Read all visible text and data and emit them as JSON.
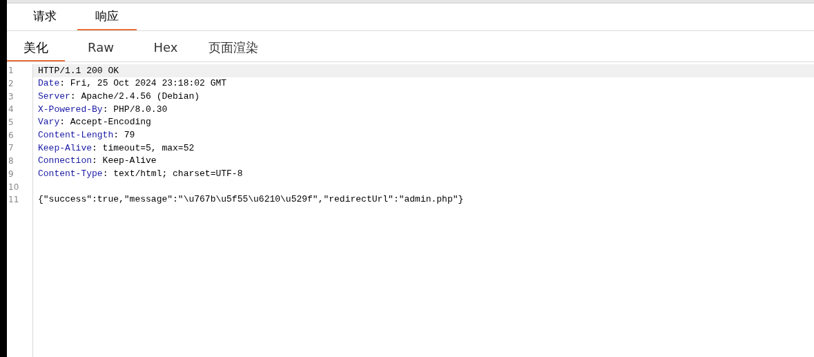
{
  "tabs": [
    {
      "label": "请求",
      "selected": false
    },
    {
      "label": "响应",
      "selected": true
    }
  ],
  "view_tabs": [
    {
      "label": "美化",
      "selected": true
    },
    {
      "label": "Raw",
      "selected": false
    },
    {
      "label": "Hex",
      "selected": false
    },
    {
      "label": "页面渲染",
      "selected": false
    }
  ],
  "lines": [
    {
      "number": "1",
      "kind": "status",
      "text": "HTTP/1.1 200 OK",
      "highlighted": true
    },
    {
      "number": "2",
      "kind": "header",
      "name": "Date",
      "value": ": Fri, 25 Oct 2024 23:18:02 GMT",
      "highlighted": false
    },
    {
      "number": "3",
      "kind": "header",
      "name": "Server",
      "value": ": Apache/2.4.56 (Debian)",
      "highlighted": false
    },
    {
      "number": "4",
      "kind": "header",
      "name": "X-Powered-By",
      "value": ": PHP/8.0.30",
      "highlighted": false
    },
    {
      "number": "5",
      "kind": "header",
      "name": "Vary",
      "value": ": Accept-Encoding",
      "highlighted": false
    },
    {
      "number": "6",
      "kind": "header",
      "name": "Content-Length",
      "value": ": 79",
      "highlighted": false
    },
    {
      "number": "7",
      "kind": "header",
      "name": "Keep-Alive",
      "value": ": timeout=5, max=52",
      "highlighted": false
    },
    {
      "number": "8",
      "kind": "header",
      "name": "Connection",
      "value": ": Keep-Alive",
      "highlighted": false
    },
    {
      "number": "9",
      "kind": "header",
      "name": "Content-Type",
      "value": ": text/html; charset=UTF-8",
      "highlighted": false
    },
    {
      "number": "10",
      "kind": "blank",
      "highlighted": false
    },
    {
      "number": "11",
      "kind": "body",
      "text": "{\"success\":true,\"message\":\"\\u767b\\u5f55\\u6210\\u529f\",\"redirectUrl\":\"admin.php\"}",
      "highlighted": false
    }
  ]
}
